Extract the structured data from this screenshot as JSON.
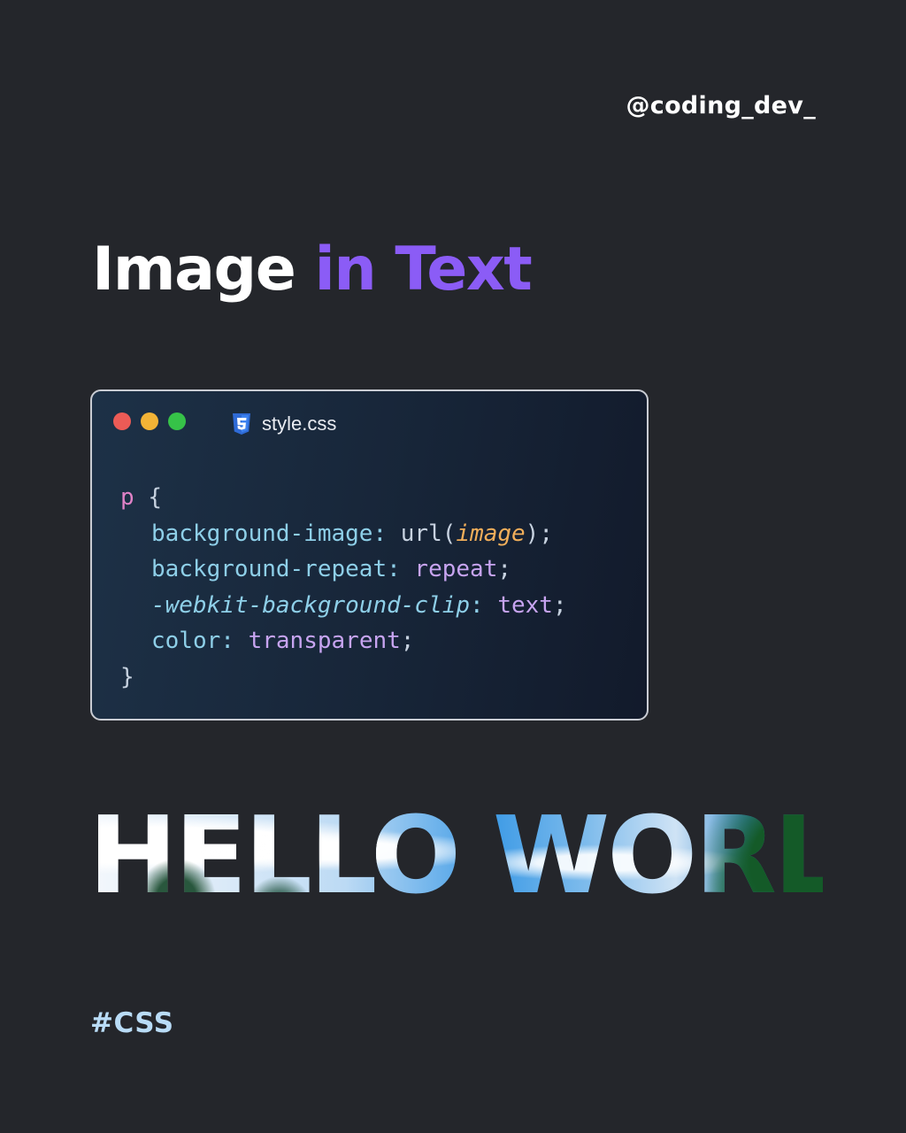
{
  "handle": "@coding_dev_",
  "title": {
    "part1": "Image",
    "part2": "in Text"
  },
  "editor": {
    "tab_filename": "style.css",
    "tab_icon": "css3-icon",
    "window_controls": [
      "close-dot",
      "minimize-dot",
      "maximize-dot"
    ],
    "code": {
      "selector": "p",
      "open_brace": "{",
      "close_brace": "}",
      "lines": [
        {
          "property": "background-image",
          "value_fn": "url(",
          "value_arg": "image",
          "value_close": ")"
        },
        {
          "property": "background-repeat",
          "value": "repeat"
        },
        {
          "property": "-webkit-background-clip",
          "value": "text"
        },
        {
          "property": "color",
          "value": "transparent"
        }
      ]
    }
  },
  "demo_text": "HELLO WORLD",
  "hashtag": "#CSS",
  "colors": {
    "background": "#24262b",
    "accent_purple": "#8b5cf6",
    "hashtag": "#b9dcf7",
    "selector": "#e082c7",
    "property": "#8ecfe8",
    "value": "#c7a4f0",
    "argument": "#f1ae5a"
  }
}
